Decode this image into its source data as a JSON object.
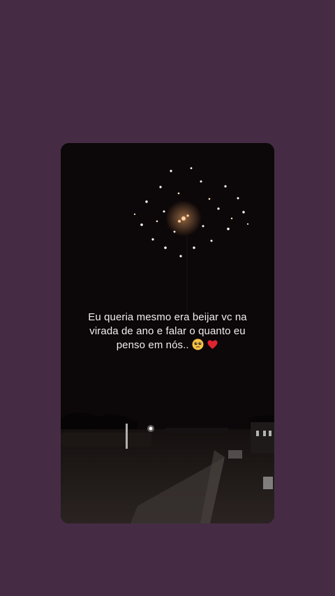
{
  "colors": {
    "background": "#452c44",
    "card": "#0c0708",
    "caption_text": "#f3eef0",
    "heart": "#e0242f"
  },
  "story": {
    "caption": {
      "line1": "Eu queria mesmo era beijar vc na",
      "line2": "virada de ano e falar o quanto eu",
      "line3": "penso em nós.."
    },
    "emojis": [
      "pleading-face-emoji",
      "red-heart-emoji"
    ]
  }
}
